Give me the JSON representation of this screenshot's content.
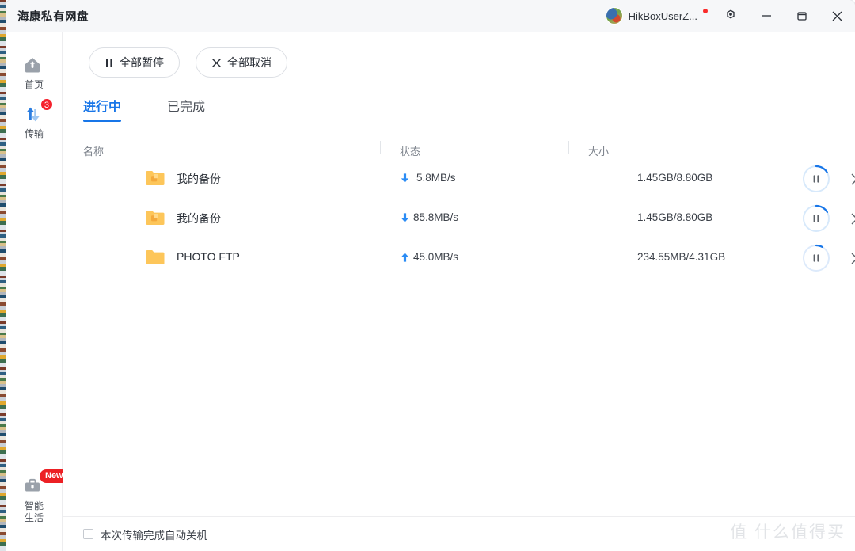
{
  "window": {
    "title": "海康私有网盘",
    "user_name": "HikBoxUserZ...",
    "has_notification_dot": true,
    "controls": {
      "settings": "settings-icon",
      "minimize": "—",
      "maximize": "▢",
      "close": "✕"
    }
  },
  "sidebar": {
    "items": [
      {
        "label": "首页",
        "icon": "home-icon",
        "badge": "",
        "active": false
      },
      {
        "label": "传输",
        "icon": "transfer-arrows-icon",
        "badge": "3",
        "active": true
      },
      {
        "label": "智能\n生活",
        "label_line1": "智能",
        "label_line2": "生活",
        "icon": "toolbox-icon",
        "badge": "New",
        "active": false
      }
    ]
  },
  "toolbar": {
    "pause_all_label": "全部暂停",
    "pause_all_icon": "pause-icon",
    "cancel_all_label": "全部取消",
    "cancel_all_icon": "close-icon"
  },
  "tabs": [
    {
      "label": "进行中",
      "active": true
    },
    {
      "label": "已完成",
      "active": false
    }
  ],
  "table": {
    "headers": {
      "name": "名称",
      "status": "状态",
      "size": "大小"
    },
    "rows": [
      {
        "name": "我的备份",
        "icon": "backup-folder-icon",
        "direction": "download",
        "direction_icon": "arrow-down-icon",
        "speed": "5.8MB/s",
        "size": "1.45GB/8.80GB",
        "progress_percent": 16,
        "action_icon": "pause-icon",
        "cancel_icon": "close-icon"
      },
      {
        "name": "我的备份",
        "icon": "backup-folder-icon",
        "direction": "download",
        "direction_icon": "arrow-down-icon",
        "speed": "85.8MB/s",
        "size": "1.45GB/8.80GB",
        "progress_percent": 16,
        "action_icon": "pause-icon",
        "cancel_icon": "close-icon"
      },
      {
        "name": "PHOTO FTP",
        "icon": "folder-icon",
        "direction": "upload",
        "direction_icon": "arrow-up-icon",
        "speed": "45.0MB/s",
        "size": "234.55MB/4.31GB",
        "progress_percent": 6,
        "action_icon": "pause-icon",
        "cancel_icon": "close-icon"
      }
    ]
  },
  "bottom": {
    "auto_shutdown_label": "本次传输完成自动关机",
    "auto_shutdown_checked": false
  },
  "watermark": "值 什么值得买",
  "colors": {
    "accent": "#1876e8",
    "badge_red": "#f5222d",
    "folder_yellow": "#fdc65a",
    "arrow_blue": "#2b8cf5"
  }
}
